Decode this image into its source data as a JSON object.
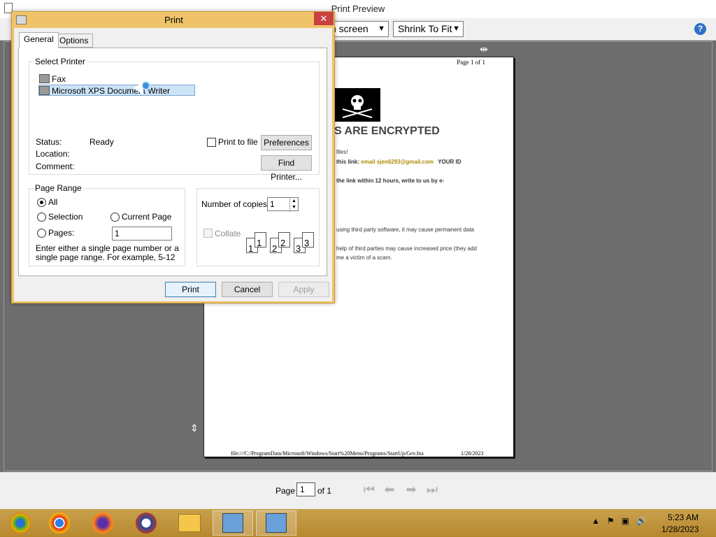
{
  "preview": {
    "title": "Print Preview",
    "close": "✕",
    "help": "?",
    "view_select": "n screen",
    "shrink_select": "Shrink To Fit",
    "page_header": "Page 1 of 1",
    "heading": "S ARE ENCRYPTED",
    "lines": [
      "files!",
      "this link:",
      "email sjen6293@gmail.com",
      "YOUR ID",
      "the link within 12 hours, write to us by e-",
      "using third party software, it may cause permanent data",
      "help of third parties may cause increased price (they add",
      "me a victim of a scam."
    ],
    "footer_path": "file:///C:/ProgramData/Microsoft/Windows/Start%20Menu/Programs/StartUp/Gev.hta",
    "footer_date": "1/28/2023",
    "pager_label": "Page",
    "pager_value": "1",
    "pager_of": "of 1"
  },
  "dialog": {
    "title": "Print",
    "close": "✕",
    "tabs": [
      "General",
      "Options"
    ],
    "select_printer_title": "Select Printer",
    "printers": [
      "Fax",
      "Microsoft XPS Document Writer"
    ],
    "status_label": "Status:",
    "status_value": "Ready",
    "location_label": "Location:",
    "comment_label": "Comment:",
    "print_to_file": "Print to file",
    "preferences": "Preferences",
    "find_printer": "Find Printer...",
    "page_range_title": "Page Range",
    "all": "All",
    "selection": "Selection",
    "current_page": "Current Page",
    "pages": "Pages:",
    "pages_value": "1",
    "range_help": "Enter either a single page number or a single page range.  For example, 5-12",
    "copies_label": "Number of copies:",
    "copies_value": "1",
    "collate": "Collate",
    "print": "Print",
    "cancel": "Cancel",
    "apply": "Apply"
  },
  "taskbar": {
    "time": "5:23 AM",
    "date": "1/28/2023"
  }
}
